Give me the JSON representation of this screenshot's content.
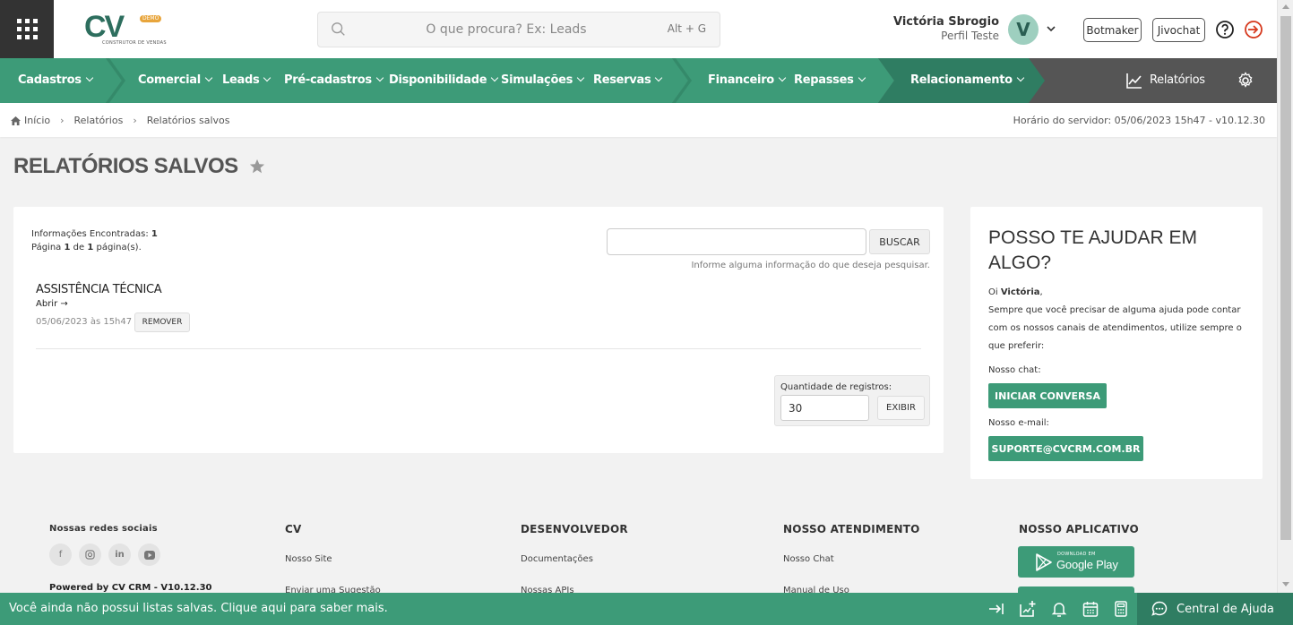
{
  "header": {
    "logo": {
      "text": "CV",
      "badge": "DEMO",
      "subtitle": "CONSTRUTOR DE VENDAS"
    },
    "search": {
      "placeholder": "O que procura? Ex: Leads",
      "shortcut": "Alt + G"
    },
    "user": {
      "name": "Victória Sbrogio",
      "role": "Perfil Teste",
      "initial": "V"
    },
    "buttons": {
      "botmaker": "Botmaker",
      "jivochat": "Jivochat"
    },
    "icons": [
      "apps-grid-icon",
      "search-icon",
      "chevron-down-icon",
      "help-circle-icon",
      "logout-icon"
    ]
  },
  "nav": {
    "items": [
      {
        "label": "Cadastros"
      },
      {
        "label": "Comercial"
      },
      {
        "label": "Leads"
      },
      {
        "label": "Pré-cadastros"
      },
      {
        "label": "Disponibilidade"
      },
      {
        "label": "Simulações"
      },
      {
        "label": "Reservas"
      },
      {
        "label": "Financeiro"
      },
      {
        "label": "Repasses"
      },
      {
        "label": "Relacionamento"
      }
    ],
    "reports": "Relatórios",
    "colors": {
      "primary": "#3d9b78",
      "dark": "#2f7d62",
      "gray": "#555555"
    }
  },
  "breadcrumb": {
    "items": [
      "Início",
      "Relatórios",
      "Relatórios salvos"
    ],
    "server_time": "Horário do servidor: 05/06/2023 15h47 - v10.12.30"
  },
  "page": {
    "title": "RELATÓRIOS SALVOS"
  },
  "results": {
    "found_label": "Informações Encontradas:",
    "found_count": "1",
    "page_prefix": "Página",
    "page_current": "1",
    "page_of": "de",
    "page_total": "1",
    "page_suffix": "página(s).",
    "search_value": "",
    "search_button": "BUSCAR",
    "search_hint": "Informe alguma informação do que deseja pesquisar.",
    "items": [
      {
        "title": "ASSISTÊNCIA TÉCNICA",
        "open": "Abrir →",
        "date": "05/06/2023 às 15h47",
        "remove": "REMOVER"
      }
    ],
    "quantity_label": "Quantidade de registros:",
    "quantity_value": "30",
    "show_button": "EXIBIR"
  },
  "help": {
    "title": "POSSO TE AJUDAR EM ALGO?",
    "greeting_prefix": "Oi",
    "greeting_name": "Victória",
    "greeting_suffix": ",",
    "message": "Sempre que você precisar de alguma ajuda pode contar com os nossos canais de atendimentos, utilize sempre o que preferir:",
    "chat_label": "Nosso chat:",
    "chat_button": "INICIAR CONVERSA",
    "mail_label": "Nosso e-mail:",
    "mail_button": "SUPORTE@CVCRM.COM.BR"
  },
  "footer": {
    "social_title": "Nossas redes sociais",
    "social_icons": [
      "facebook-icon",
      "instagram-icon",
      "linkedin-icon",
      "youtube-icon"
    ],
    "powered": "Powered by CV CRM - V10.12.30",
    "columns": [
      {
        "title": "CV",
        "links": [
          "Nosso Site",
          "Enviar uma Sugestão"
        ]
      },
      {
        "title": "DESENVOLVEDOR",
        "links": [
          "Documentações",
          "Nossas APIs"
        ]
      },
      {
        "title": "NOSSO ATENDIMENTO",
        "links": [
          "Nosso Chat",
          "Manual de Uso"
        ]
      }
    ],
    "app_title": "NOSSO APLICATIVO",
    "google_play_small": "DOWNLOAD EM",
    "google_play_big": "Google Play"
  },
  "bottom_bar": {
    "message": "Você ainda não possui listas salvas. Clique aqui para saber mais.",
    "icons": [
      "collapse-right-icon",
      "add-list-icon",
      "bell-icon",
      "calendar-icon",
      "calculator-icon"
    ],
    "help_label": "Central de Ajuda"
  }
}
